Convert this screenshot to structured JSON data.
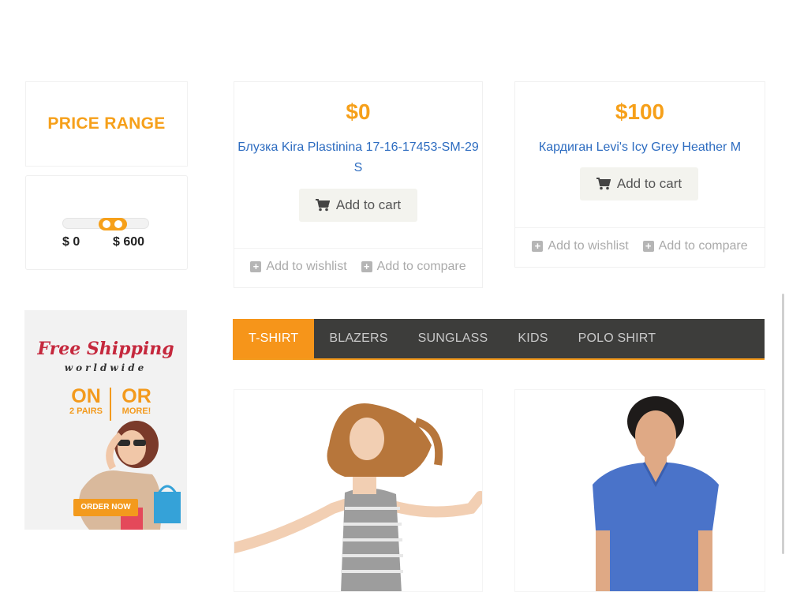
{
  "sidebar": {
    "price_range_title": "PRICE RANGE",
    "slider": {
      "min_label": "$ 0",
      "max_label": "$ 600"
    }
  },
  "banner": {
    "title": "Free Shipping",
    "subtitle": "worldwide",
    "offer_left_big": "ON",
    "offer_left_small": "2 PAIRS",
    "offer_right_big": "OR",
    "offer_right_small": "MORE!",
    "button_label": "ORDER NOW"
  },
  "products": [
    {
      "price": "$0",
      "name": "Блузка Kira Plastinina 17-16-17453-SM-29 S",
      "cart_label": "Add to cart",
      "wishlist_label": "Add to wishlist",
      "compare_label": "Add to compare"
    },
    {
      "price": "$100",
      "name": "Кардиган Levi's Icy Grey Heather M",
      "cart_label": "Add to cart",
      "wishlist_label": "Add to wishlist",
      "compare_label": "Add to compare"
    }
  ],
  "tabs": [
    "T-SHIRT",
    "BLAZERS",
    "SUNGLASS",
    "KIDS",
    "POLO SHIRT"
  ],
  "active_tab": "T-SHIRT",
  "colors": {
    "accent": "#f6a01a",
    "tab_bar": "#3d3d3b",
    "link": "#2d6cc0",
    "banner_red": "#c5283d"
  },
  "icons": [
    "cart-icon",
    "plus-square-icon"
  ]
}
